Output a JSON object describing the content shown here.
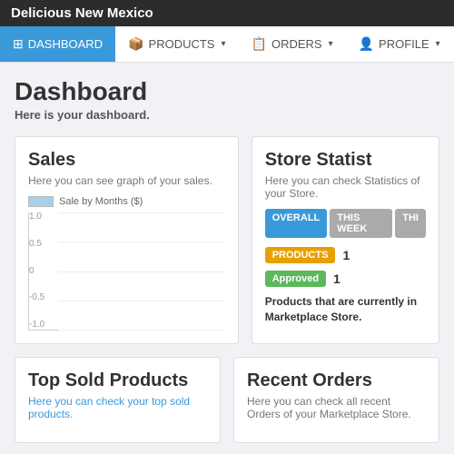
{
  "topbar": {
    "title": "Delicious New Mexico"
  },
  "navbar": {
    "items": [
      {
        "id": "dashboard",
        "label": "DASHBOARD",
        "icon": "⊞",
        "active": true,
        "hasCaret": false
      },
      {
        "id": "products",
        "label": "PRODUCTS",
        "icon": "📦",
        "active": false,
        "hasCaret": true
      },
      {
        "id": "orders",
        "label": "ORDERS",
        "icon": "📋",
        "active": false,
        "hasCaret": true
      },
      {
        "id": "profile",
        "label": "PROFILE",
        "icon": "👤",
        "active": false,
        "hasCaret": true
      }
    ]
  },
  "page": {
    "title": "Dashboard",
    "subtitle": "Here is your dashboard."
  },
  "sales_card": {
    "title": "Sales",
    "subtitle": "Here you can see graph of your sales.",
    "legend_label": "Sale by Months ($)",
    "y_labels": [
      "1.0",
      "0.5",
      "0",
      "-0.5",
      "-1.0"
    ]
  },
  "store_card": {
    "title": "Store Statist",
    "subtitle": "Here you can check Statistics of your Store.",
    "tabs": [
      "OVERALL",
      "THIS WEEK",
      "THI"
    ],
    "products_label": "PRODUCTS",
    "products_count": "1",
    "approved_label": "Approved",
    "approved_count": "1",
    "description": "Products that are currently in Marketplace Store."
  },
  "bottom_cards": {
    "left": {
      "title": "Top Sold Products",
      "subtitle": "Here you can check your top sold products."
    },
    "right": {
      "title": "Recent Orders",
      "subtitle": "Here you can check all recent Orders of your Marketplace Store."
    }
  }
}
